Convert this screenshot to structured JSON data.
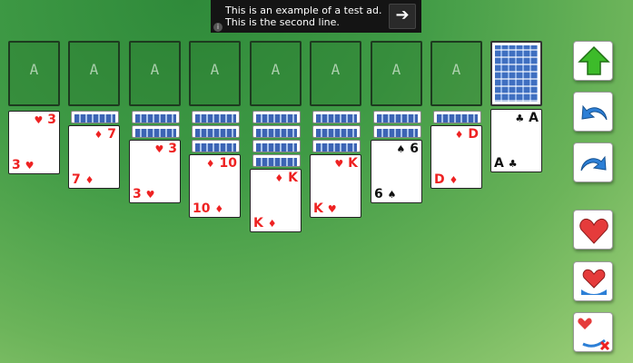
{
  "ad": {
    "text": "This is an example of a test ad. This is the second line.",
    "arrow": "➔",
    "info": "i"
  },
  "foundation_label": "A",
  "foundations": [
    "A",
    "A",
    "A",
    "A",
    "A",
    "A",
    "A",
    "A"
  ],
  "tableau": [
    {
      "backs": 0,
      "rank": "3",
      "suit": "♥",
      "color": "red"
    },
    {
      "backs": 1,
      "rank": "7",
      "suit": "♦",
      "color": "red"
    },
    {
      "backs": 2,
      "rank": "3",
      "suit": "♥",
      "color": "red"
    },
    {
      "backs": 3,
      "rank": "10",
      "suit": "♦",
      "color": "red"
    },
    {
      "backs": 4,
      "rank": "K",
      "suit": "♦",
      "color": "red"
    },
    {
      "backs": 3,
      "rank": "K",
      "suit": "♥",
      "color": "red"
    },
    {
      "backs": 2,
      "rank": "6",
      "suit": "♠",
      "color": "black"
    },
    {
      "backs": 1,
      "rank": "D",
      "suit": "♦",
      "color": "red"
    }
  ],
  "waste_card": {
    "rank": "A",
    "suit": "♣",
    "color": "black"
  },
  "toolbar": [
    "up-arrow-icon",
    "undo-icon",
    "redo-icon",
    "heart-hint-icon",
    "heart-auto-icon",
    "heart-clear-icon"
  ],
  "colors": {
    "red": "#e22222",
    "black": "#111111",
    "arrow_green": "#3dbb2a",
    "arrow_blue": "#2c7fd6"
  }
}
